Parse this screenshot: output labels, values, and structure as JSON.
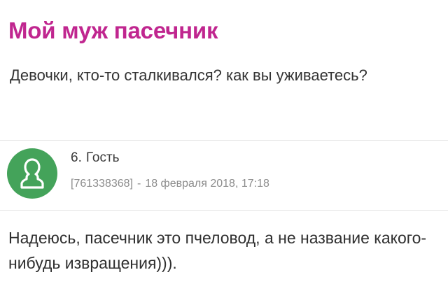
{
  "post": {
    "title": "Мой муж пасечник",
    "body": "Девочки, кто-то сталкивался? как вы уживаетесь?"
  },
  "comment": {
    "number": "6.",
    "author": "Гость",
    "id": "[761338368]",
    "separator": "-",
    "date": "18 февраля 2018, 17:18",
    "text": "Надеюсь, пасечник это пчеловод, а не название какого-нибудь извращения))).",
    "avatar_icon": "user-silhouette-icon",
    "avatar_color": "#44a35a"
  },
  "colors": {
    "title": "#c0268f"
  }
}
